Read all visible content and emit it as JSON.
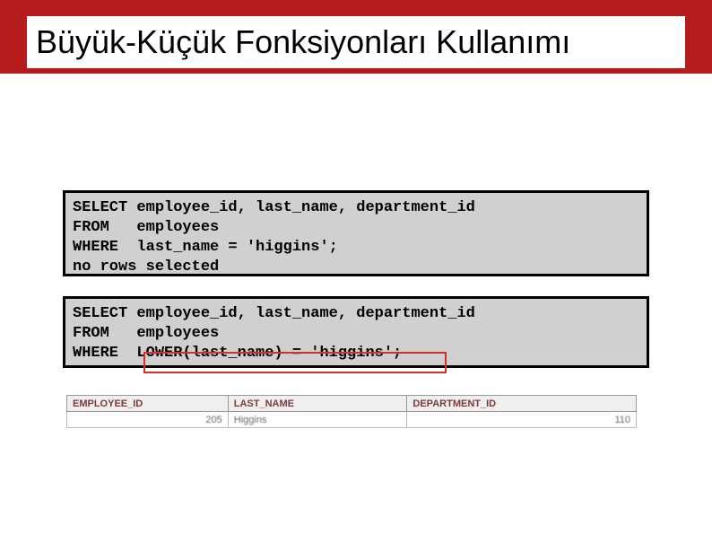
{
  "title": "Büyük-Küçük Fonksiyonları Kullanımı",
  "code1": {
    "line1": "SELECT employee_id, last_name, department_id",
    "line2": "FROM   employees",
    "line3": "WHERE  last_name = 'higgins';",
    "line4": "no rows selected"
  },
  "code2": {
    "line1": "SELECT employee_id, last_name, department_id",
    "line2": "FROM   employees",
    "line3": "WHERE  LOWER(last_name) = 'higgins';"
  },
  "result": {
    "headers": {
      "employee_id": "EMPLOYEE_ID",
      "last_name": "LAST_NAME",
      "department_id": "DEPARTMENT_ID"
    },
    "row": {
      "employee_id": "205",
      "last_name": "Higgins",
      "department_id": "110"
    }
  }
}
